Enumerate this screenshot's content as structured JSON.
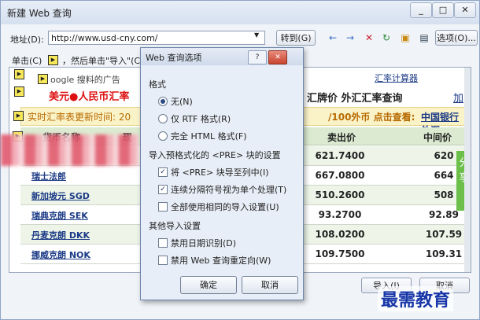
{
  "window": {
    "title": "新建 Web 查询"
  },
  "address": {
    "label": "地址(D):",
    "url": "http://www.usd-cny.com/",
    "go_label": "转到(G)",
    "options_label": "选项(O)..."
  },
  "instructions": {
    "text_a": "单击(C)",
    "text_b": "，然后单击\"导入\"(C"
  },
  "page": {
    "ad_text": "oogle 搜料的广告",
    "heading_red": "美元●人民币汇率",
    "heading_right": "汇牌价 外汇汇率查询",
    "calc_link": "汇率计算器",
    "add_link": "加",
    "update_text": "实时汇率表更新时间: 20",
    "update_mid": "/100外币 点击查看:",
    "boc_link": "中国银行外汇",
    "columns": [
      "货币名称",
      "现",
      "卖出价",
      "中间价"
    ],
    "rows": [
      {
        "name": "瑞士法郎",
        "sell": "667.0800",
        "mid": "664"
      },
      {
        "name": "新加坡元 SGD",
        "sell": "510.2600",
        "mid": "508"
      },
      {
        "name": "瑞典克朗 SEK",
        "sell": "93.2700",
        "mid": "92.89"
      },
      {
        "name": "丹麦克朗 DKK",
        "sell": "108.0200",
        "mid": "107.59"
      },
      {
        "name": "挪威克朗 NOK",
        "sell": "109.7500",
        "mid": "109.31"
      }
    ],
    "first_row": {
      "sell": "621.7400",
      "mid": "620"
    }
  },
  "share": {
    "label": "分享"
  },
  "import_label": "导入(I)",
  "cancel_label": "取消",
  "dialog": {
    "title": "Web 查询选项",
    "format_label": "格式",
    "format_options": [
      "无(N)",
      "仅 RTF 格式(R)",
      "完全 HTML 格式(F)"
    ],
    "pre_label": "导入预格式化的 <PRE> 块的设置",
    "pre_options": [
      "将 <PRE> 块导至列中(I)",
      "连续分隔符号视为单个处理(T)",
      "全部使用相同的导入设置(U)"
    ],
    "other_label": "其他导入设置",
    "other_options": [
      "禁用日期识别(D)",
      "禁用 Web 查询重定向(W)"
    ],
    "ok_label": "确定",
    "cancel_label": "取消"
  },
  "watermark": "最需教育"
}
